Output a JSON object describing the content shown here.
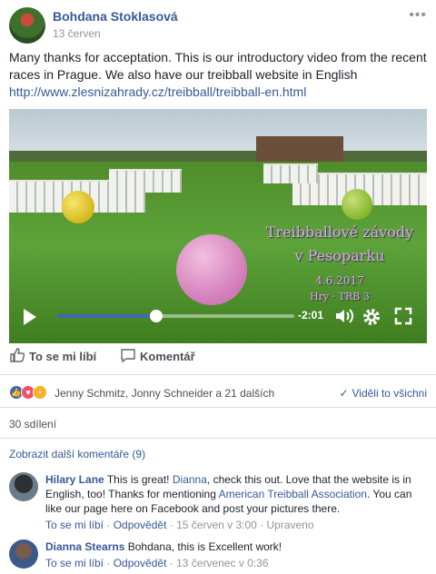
{
  "post": {
    "author": "Bohdana Stoklasová",
    "date": "13 červen",
    "more_menu": "•••",
    "text": "Many thanks for acceptation. This is our introductory video from the recent races in Prague. We also have our treibball website in English",
    "link": "http://www.zlesnizahrady.cz/treibball/treibball-en.html"
  },
  "video": {
    "overlay": {
      "title": "Treibballové závody",
      "subtitle": "v Pesoparku",
      "date": "4.6.2017",
      "line": "Hry · TRB 3"
    },
    "progress_fraction": 0.42,
    "time_remaining": "-2:01",
    "icons": [
      "play-icon",
      "volume-icon",
      "gear-icon",
      "fullscreen-icon"
    ]
  },
  "actions": {
    "like": "To se mi líbí",
    "comment": "Komentář"
  },
  "reactions": {
    "names": "Jenny Schmitz, Jonny Schneider a 21 dalších",
    "view_all": "Viděli to všichni"
  },
  "shares": "30 sdílení",
  "more_comments": "Zobrazit další komentáře (9)",
  "comments": [
    {
      "author": "Hilary Lane",
      "text1": "This is great!",
      "mention": "Dianna",
      "text2": ", check this out. Love that the website is in English, too! Thanks for mentioning",
      "link": "American Treibball Association",
      "text3": ". You can like our page here on Facebook and post your pictures there.",
      "like": "To se mi líbí",
      "reply": "Odpovědět",
      "time": "15 červen v 3:00",
      "edited": "Upraveno"
    },
    {
      "author": "Dianna Stearns",
      "text1": "Bohdana, this is Excellent work!",
      "like": "To se mi líbí",
      "reply": "Odpovědět",
      "time": "13 červenec v 0:36"
    }
  ]
}
